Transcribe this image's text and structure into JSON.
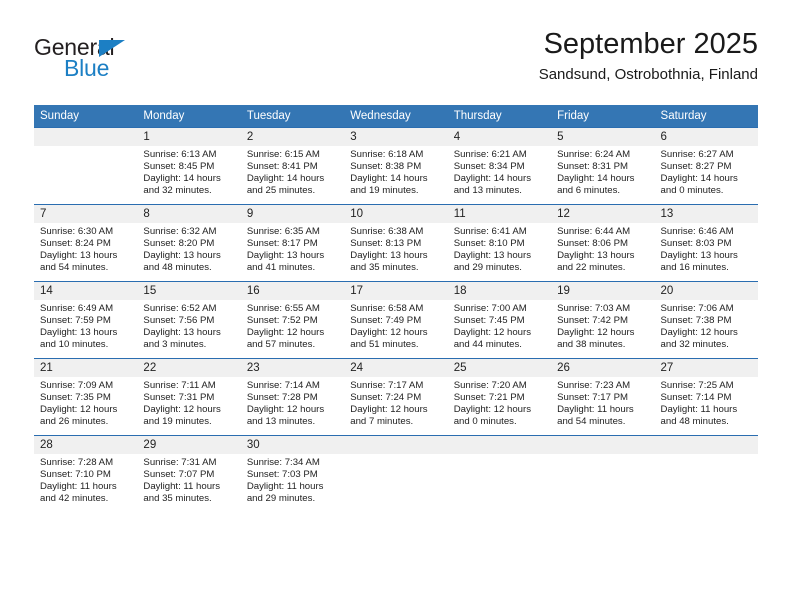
{
  "brand": {
    "name_top": "General",
    "name_bottom": "Blue",
    "accent_color": "#1c7fc4"
  },
  "header": {
    "title": "September 2025",
    "subtitle": "Sandsund, Ostrobothnia, Finland"
  },
  "theme": {
    "header_row_bg": "#3476b4",
    "week_divider": "#2a6db0",
    "daynum_bg": "#f0f0f0"
  },
  "weekdays": [
    "Sunday",
    "Monday",
    "Tuesday",
    "Wednesday",
    "Thursday",
    "Friday",
    "Saturday"
  ],
  "weeks": [
    [
      {
        "day": "",
        "sunrise": "",
        "sunset": "",
        "daylight1": "",
        "daylight2": ""
      },
      {
        "day": "1",
        "sunrise": "Sunrise: 6:13 AM",
        "sunset": "Sunset: 8:45 PM",
        "daylight1": "Daylight: 14 hours",
        "daylight2": "and 32 minutes."
      },
      {
        "day": "2",
        "sunrise": "Sunrise: 6:15 AM",
        "sunset": "Sunset: 8:41 PM",
        "daylight1": "Daylight: 14 hours",
        "daylight2": "and 25 minutes."
      },
      {
        "day": "3",
        "sunrise": "Sunrise: 6:18 AM",
        "sunset": "Sunset: 8:38 PM",
        "daylight1": "Daylight: 14 hours",
        "daylight2": "and 19 minutes."
      },
      {
        "day": "4",
        "sunrise": "Sunrise: 6:21 AM",
        "sunset": "Sunset: 8:34 PM",
        "daylight1": "Daylight: 14 hours",
        "daylight2": "and 13 minutes."
      },
      {
        "day": "5",
        "sunrise": "Sunrise: 6:24 AM",
        "sunset": "Sunset: 8:31 PM",
        "daylight1": "Daylight: 14 hours",
        "daylight2": "and 6 minutes."
      },
      {
        "day": "6",
        "sunrise": "Sunrise: 6:27 AM",
        "sunset": "Sunset: 8:27 PM",
        "daylight1": "Daylight: 14 hours",
        "daylight2": "and 0 minutes."
      }
    ],
    [
      {
        "day": "7",
        "sunrise": "Sunrise: 6:30 AM",
        "sunset": "Sunset: 8:24 PM",
        "daylight1": "Daylight: 13 hours",
        "daylight2": "and 54 minutes."
      },
      {
        "day": "8",
        "sunrise": "Sunrise: 6:32 AM",
        "sunset": "Sunset: 8:20 PM",
        "daylight1": "Daylight: 13 hours",
        "daylight2": "and 48 minutes."
      },
      {
        "day": "9",
        "sunrise": "Sunrise: 6:35 AM",
        "sunset": "Sunset: 8:17 PM",
        "daylight1": "Daylight: 13 hours",
        "daylight2": "and 41 minutes."
      },
      {
        "day": "10",
        "sunrise": "Sunrise: 6:38 AM",
        "sunset": "Sunset: 8:13 PM",
        "daylight1": "Daylight: 13 hours",
        "daylight2": "and 35 minutes."
      },
      {
        "day": "11",
        "sunrise": "Sunrise: 6:41 AM",
        "sunset": "Sunset: 8:10 PM",
        "daylight1": "Daylight: 13 hours",
        "daylight2": "and 29 minutes."
      },
      {
        "day": "12",
        "sunrise": "Sunrise: 6:44 AM",
        "sunset": "Sunset: 8:06 PM",
        "daylight1": "Daylight: 13 hours",
        "daylight2": "and 22 minutes."
      },
      {
        "day": "13",
        "sunrise": "Sunrise: 6:46 AM",
        "sunset": "Sunset: 8:03 PM",
        "daylight1": "Daylight: 13 hours",
        "daylight2": "and 16 minutes."
      }
    ],
    [
      {
        "day": "14",
        "sunrise": "Sunrise: 6:49 AM",
        "sunset": "Sunset: 7:59 PM",
        "daylight1": "Daylight: 13 hours",
        "daylight2": "and 10 minutes."
      },
      {
        "day": "15",
        "sunrise": "Sunrise: 6:52 AM",
        "sunset": "Sunset: 7:56 PM",
        "daylight1": "Daylight: 13 hours",
        "daylight2": "and 3 minutes."
      },
      {
        "day": "16",
        "sunrise": "Sunrise: 6:55 AM",
        "sunset": "Sunset: 7:52 PM",
        "daylight1": "Daylight: 12 hours",
        "daylight2": "and 57 minutes."
      },
      {
        "day": "17",
        "sunrise": "Sunrise: 6:58 AM",
        "sunset": "Sunset: 7:49 PM",
        "daylight1": "Daylight: 12 hours",
        "daylight2": "and 51 minutes."
      },
      {
        "day": "18",
        "sunrise": "Sunrise: 7:00 AM",
        "sunset": "Sunset: 7:45 PM",
        "daylight1": "Daylight: 12 hours",
        "daylight2": "and 44 minutes."
      },
      {
        "day": "19",
        "sunrise": "Sunrise: 7:03 AM",
        "sunset": "Sunset: 7:42 PM",
        "daylight1": "Daylight: 12 hours",
        "daylight2": "and 38 minutes."
      },
      {
        "day": "20",
        "sunrise": "Sunrise: 7:06 AM",
        "sunset": "Sunset: 7:38 PM",
        "daylight1": "Daylight: 12 hours",
        "daylight2": "and 32 minutes."
      }
    ],
    [
      {
        "day": "21",
        "sunrise": "Sunrise: 7:09 AM",
        "sunset": "Sunset: 7:35 PM",
        "daylight1": "Daylight: 12 hours",
        "daylight2": "and 26 minutes."
      },
      {
        "day": "22",
        "sunrise": "Sunrise: 7:11 AM",
        "sunset": "Sunset: 7:31 PM",
        "daylight1": "Daylight: 12 hours",
        "daylight2": "and 19 minutes."
      },
      {
        "day": "23",
        "sunrise": "Sunrise: 7:14 AM",
        "sunset": "Sunset: 7:28 PM",
        "daylight1": "Daylight: 12 hours",
        "daylight2": "and 13 minutes."
      },
      {
        "day": "24",
        "sunrise": "Sunrise: 7:17 AM",
        "sunset": "Sunset: 7:24 PM",
        "daylight1": "Daylight: 12 hours",
        "daylight2": "and 7 minutes."
      },
      {
        "day": "25",
        "sunrise": "Sunrise: 7:20 AM",
        "sunset": "Sunset: 7:21 PM",
        "daylight1": "Daylight: 12 hours",
        "daylight2": "and 0 minutes."
      },
      {
        "day": "26",
        "sunrise": "Sunrise: 7:23 AM",
        "sunset": "Sunset: 7:17 PM",
        "daylight1": "Daylight: 11 hours",
        "daylight2": "and 54 minutes."
      },
      {
        "day": "27",
        "sunrise": "Sunrise: 7:25 AM",
        "sunset": "Sunset: 7:14 PM",
        "daylight1": "Daylight: 11 hours",
        "daylight2": "and 48 minutes."
      }
    ],
    [
      {
        "day": "28",
        "sunrise": "Sunrise: 7:28 AM",
        "sunset": "Sunset: 7:10 PM",
        "daylight1": "Daylight: 11 hours",
        "daylight2": "and 42 minutes."
      },
      {
        "day": "29",
        "sunrise": "Sunrise: 7:31 AM",
        "sunset": "Sunset: 7:07 PM",
        "daylight1": "Daylight: 11 hours",
        "daylight2": "and 35 minutes."
      },
      {
        "day": "30",
        "sunrise": "Sunrise: 7:34 AM",
        "sunset": "Sunset: 7:03 PM",
        "daylight1": "Daylight: 11 hours",
        "daylight2": "and 29 minutes."
      },
      {
        "day": "",
        "sunrise": "",
        "sunset": "",
        "daylight1": "",
        "daylight2": ""
      },
      {
        "day": "",
        "sunrise": "",
        "sunset": "",
        "daylight1": "",
        "daylight2": ""
      },
      {
        "day": "",
        "sunrise": "",
        "sunset": "",
        "daylight1": "",
        "daylight2": ""
      },
      {
        "day": "",
        "sunrise": "",
        "sunset": "",
        "daylight1": "",
        "daylight2": ""
      }
    ]
  ]
}
